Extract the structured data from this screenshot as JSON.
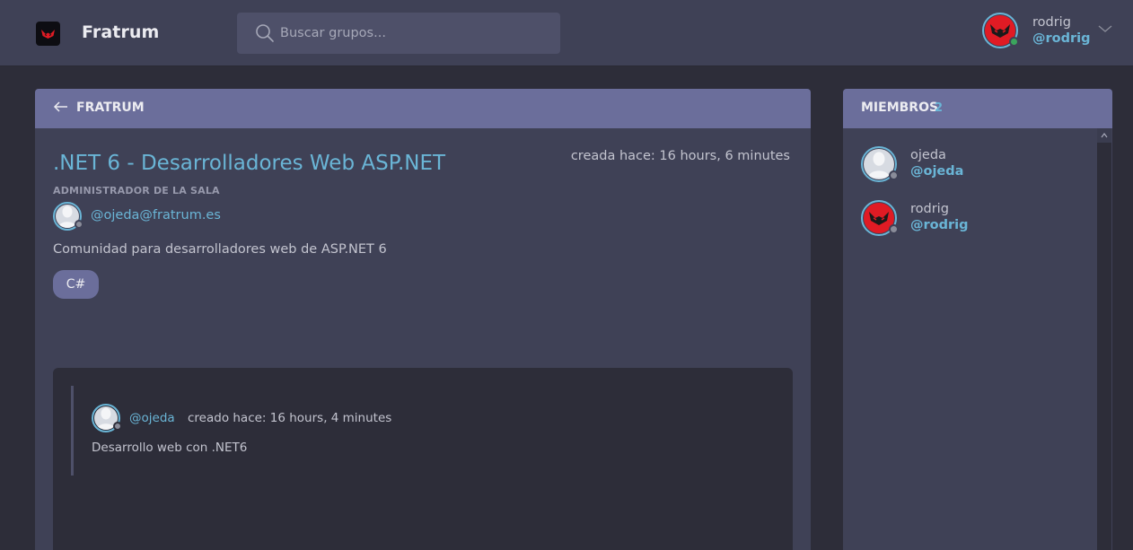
{
  "header": {
    "app_name": "Fratrum",
    "logo_icon": "fratrum-logo-icon",
    "search": {
      "placeholder": "Buscar grupos..."
    },
    "user": {
      "name": "rodrig",
      "handle": "@rodrig",
      "status": "online"
    }
  },
  "room_panel": {
    "header_label": "FRATRUM",
    "title": ".NET 6 - Desarrolladores Web ASP.NET",
    "created": "creada hace: 16 hours, 6 minutes",
    "admin_label": "ADMINISTRADOR DE LA SALA",
    "admin_email": "@ojeda@fratrum.es",
    "description": "Comunidad para desarrolladores web de ASP.NET 6",
    "tags": [
      "C#"
    ],
    "messages": [
      {
        "handle": "@ojeda",
        "time": "creado hace: 16 hours, 4 minutes",
        "text": "Desarrollo web con .NET6"
      }
    ]
  },
  "members_panel": {
    "title": "MIEMBROS",
    "count": "2",
    "members": [
      {
        "name": "ojeda",
        "handle": "@ojeda",
        "avatar": "default-user",
        "status": "offline"
      },
      {
        "name": "rodrig",
        "handle": "@rodrig",
        "avatar": "red-mask",
        "status": "offline"
      }
    ]
  },
  "colors": {
    "accent": "#6ab5d6",
    "header_bg": "#3f4156",
    "panel_head": "#6b6e9b",
    "background": "#2d2d39",
    "online": "#3ba55d",
    "offline": "#8a8c99"
  }
}
